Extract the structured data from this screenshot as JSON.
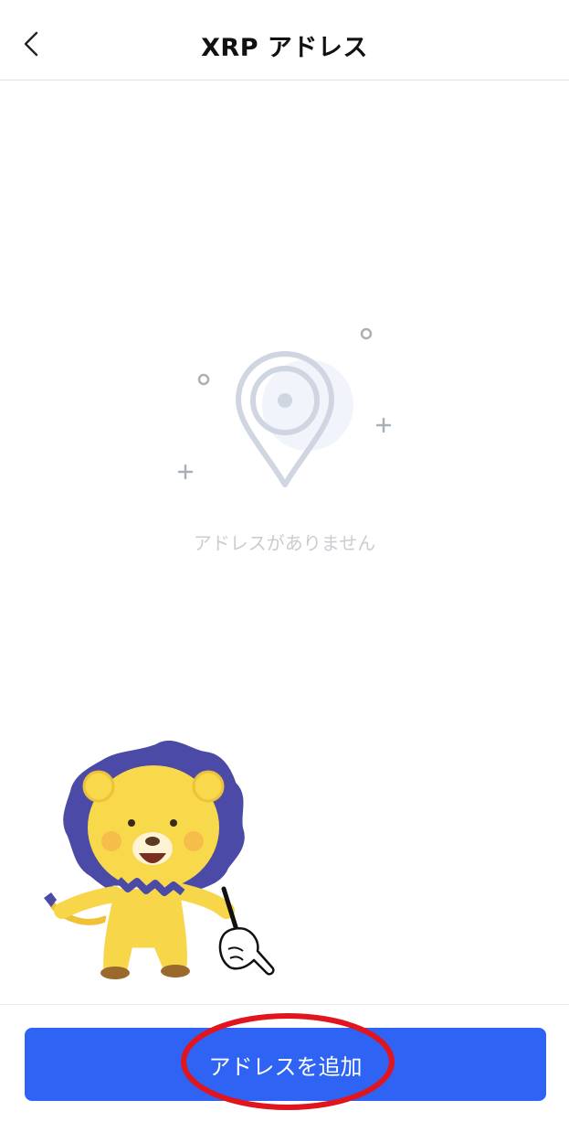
{
  "header": {
    "title": "XRP アドレス",
    "back_icon": "chevron-left-icon"
  },
  "empty_state": {
    "icon": "location-pin-icon",
    "message": "アドレスがありません"
  },
  "mascot": {
    "description_icon": "lion-mascot-icon",
    "pointer_icon": "pointing-hand-icon"
  },
  "footer": {
    "add_button_label": "アドレスを追加"
  },
  "colors": {
    "primary": "#2f63f3",
    "highlight_circle": "#e0151d",
    "empty_text": "#c9ccd1",
    "pin_stroke": "#cfd6e2"
  }
}
